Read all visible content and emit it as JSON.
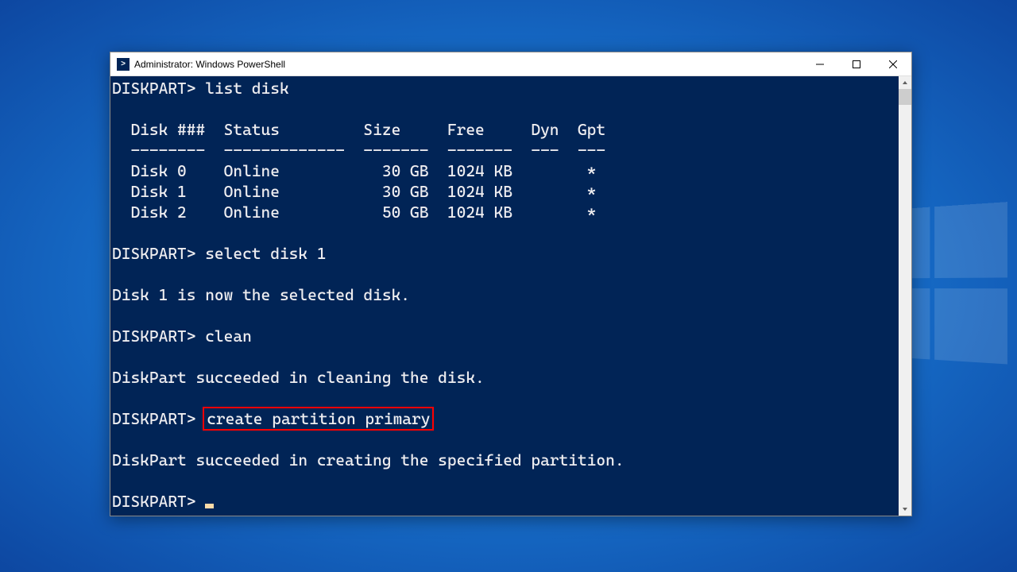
{
  "window": {
    "title": "Administrator: Windows PowerShell"
  },
  "terminal": {
    "lines": [
      {
        "prompt": "DISKPART> ",
        "cmd": "list disk"
      },
      {
        "text": ""
      },
      {
        "text": "  Disk ###  Status         Size     Free     Dyn  Gpt"
      },
      {
        "text": "  --------  -------------  -------  -------  ---  ---"
      },
      {
        "text": "  Disk 0    Online           30 GB  1024 KB        *"
      },
      {
        "text": "  Disk 1    Online           30 GB  1024 KB        *"
      },
      {
        "text": "  Disk 2    Online           50 GB  1024 KB        *"
      },
      {
        "text": ""
      },
      {
        "prompt": "DISKPART> ",
        "cmd": "select disk 1"
      },
      {
        "text": ""
      },
      {
        "text": "Disk 1 is now the selected disk."
      },
      {
        "text": ""
      },
      {
        "prompt": "DISKPART> ",
        "cmd": "clean"
      },
      {
        "text": ""
      },
      {
        "text": "DiskPart succeeded in cleaning the disk."
      },
      {
        "text": ""
      },
      {
        "prompt": "DISKPART> ",
        "cmd": "create partition primary",
        "highlighted": true
      },
      {
        "text": ""
      },
      {
        "text": "DiskPart succeeded in creating the specified partition."
      },
      {
        "text": ""
      },
      {
        "prompt": "DISKPART> ",
        "cursor": true
      }
    ]
  }
}
